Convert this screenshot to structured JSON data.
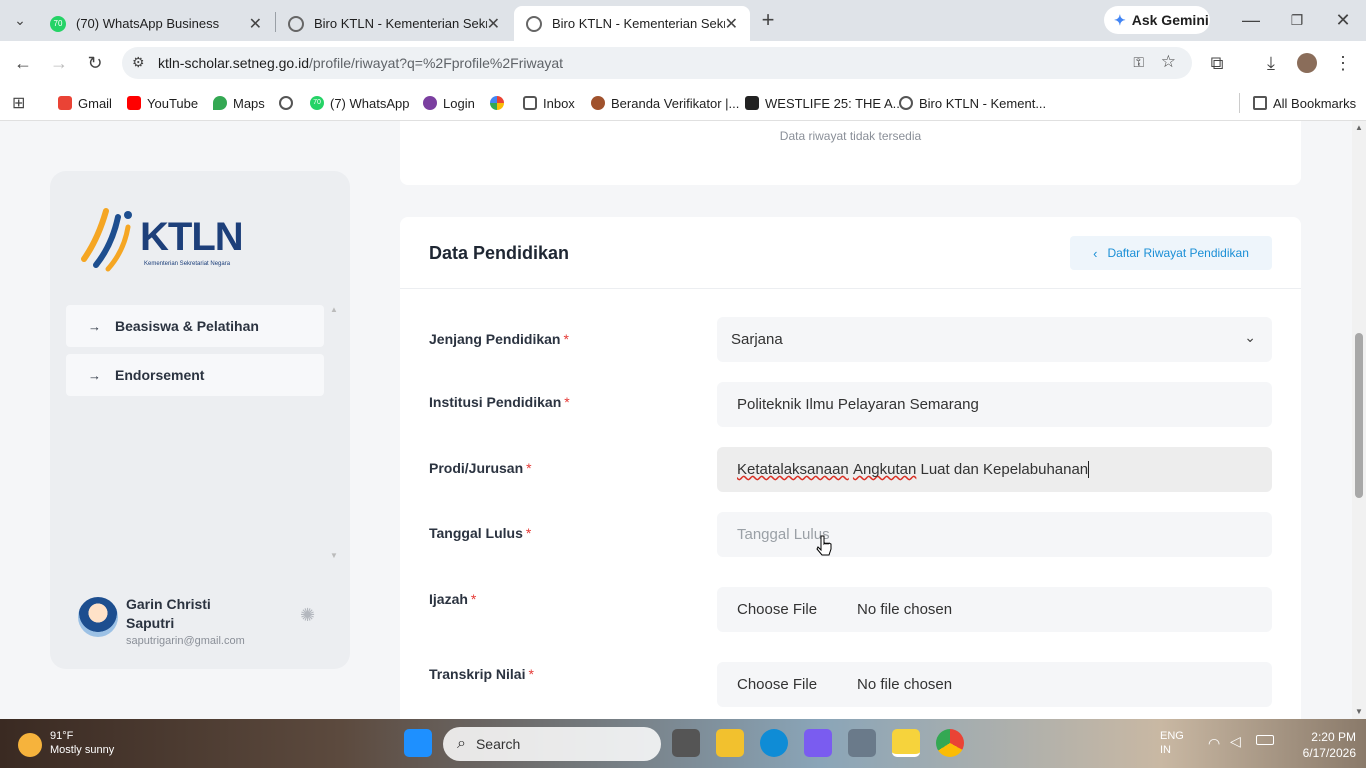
{
  "browser": {
    "tabs": [
      {
        "title": "(70) WhatsApp Business",
        "badge": "70",
        "active": false
      },
      {
        "title": "Biro KTLN - Kementerian Sekret",
        "active": false
      },
      {
        "title": "Biro KTLN - Kementerian Sekret",
        "active": true
      }
    ],
    "ask_gemini": "Ask Gemini",
    "url_host": "ktln-scholar.setneg.go.id",
    "url_path": "/profile/riwayat?q=%2Fprofile%2Friwayat",
    "bookmarks": [
      "Gmail",
      "YouTube",
      "Maps",
      "(7) WhatsApp",
      "Login",
      "Inbox",
      "Beranda Verifikator |...",
      "WESTLIFE 25: THE A...",
      "Biro KTLN - Kement..."
    ],
    "bookmarks_badge": "70",
    "all_bookmarks": "All Bookmarks"
  },
  "top_card": {
    "empty_message": "Data riwayat tidak tersedia"
  },
  "sidebar": {
    "logo_text": "KTLN",
    "logo_sub": "Kementerian Sekretariat Negara",
    "items": [
      {
        "label": "Beasiswa & Pelatihan"
      },
      {
        "label": "Endorsement"
      }
    ],
    "user": {
      "name": "Garin Christi Saputri",
      "email": "saputrigarin@gmail.com"
    }
  },
  "form": {
    "title": "Data Pendidikan",
    "back_button": "Daftar Riwayat Pendidikan",
    "required_mark": "*",
    "fields": [
      {
        "label": "Jenjang Pendidikan",
        "value": "Sarjana"
      },
      {
        "label": "Institusi Pendidikan",
        "value": "Politeknik Ilmu Pelayaran Semarang"
      },
      {
        "label": "Prodi/Jurusan",
        "value_misspelled_1": "Ketatalaksanaan",
        "value_mid": " ",
        "value_misspelled_2": "Angkutan",
        "value_rest": " Luat dan Kepelabuhanan"
      },
      {
        "label": "Tanggal Lulus",
        "placeholder": "Tanggal Lulus"
      },
      {
        "label": "Ijazah",
        "button": "Choose File",
        "status": "No file chosen"
      },
      {
        "label": "Transkrip Nilai",
        "button": "Choose File",
        "status": "No file chosen"
      }
    ]
  },
  "taskbar": {
    "temp": "91°F",
    "weather": "Mostly sunny",
    "search": "Search",
    "lang_1": "ENG",
    "lang_2": "IN",
    "time": "2:20 PM",
    "date": "6/17/2026"
  }
}
